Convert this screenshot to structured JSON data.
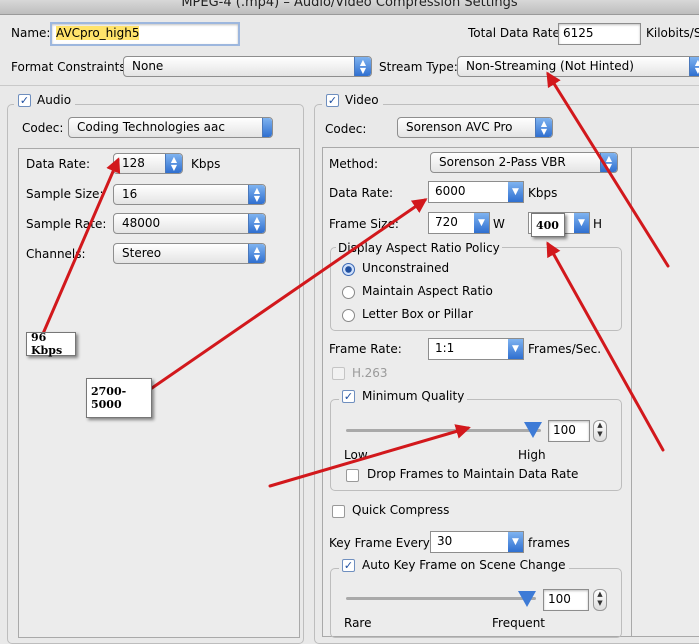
{
  "window": {
    "title": "MPEG-4 (.mp4) – Audio/Video Compression Settings"
  },
  "name": {
    "label": "Name:",
    "value": "AVCpro_high5"
  },
  "total_rate": {
    "label": "Total Data Rate:",
    "value": "6125",
    "unit": "Kilobits/Se"
  },
  "format_constraints": {
    "label": "Format Constraints:",
    "value": "None"
  },
  "stream_type": {
    "label": "Stream Type:",
    "value": "Non-Streaming (Not Hinted)"
  },
  "audio": {
    "checkbox_label": "Audio",
    "codec_label": "Codec:",
    "codec": "Coding Technologies aac",
    "data_rate_label": "Data Rate:",
    "data_rate": "128",
    "data_rate_unit": "Kbps",
    "sample_size_label": "Sample Size:",
    "sample_size": "16",
    "sample_rate_label": "Sample Rate:",
    "sample_rate": "48000",
    "channels_label": "Channels:",
    "channels": "Stereo"
  },
  "video": {
    "checkbox_label": "Video",
    "codec_label": "Codec:",
    "codec": "Sorenson AVC Pro",
    "method_label": "Method:",
    "method": "Sorenson 2-Pass VBR",
    "data_rate_label": "Data Rate:",
    "data_rate": "6000",
    "data_rate_unit": "Kbps",
    "frame_size_label": "Frame Size:",
    "frame_width": "720",
    "w_label": "W",
    "h_label": "H",
    "aspect_title": "Display Aspect Ratio Policy",
    "aspect_options": [
      "Unconstrained",
      "Maintain Aspect Ratio",
      "Letter Box or Pillar"
    ],
    "frame_rate_label": "Frame Rate:",
    "frame_rate": "1:1",
    "frame_rate_unit": "Frames/Sec.",
    "h263_label": "H.263",
    "min_quality_label": "Minimum Quality",
    "quality_low": "Low",
    "quality_high": "High",
    "quality_value": "100",
    "quality_fraction": 1.0,
    "drop_frames_label": "Drop Frames to Maintain Data Rate",
    "quick_compress_label": "Quick Compress",
    "key_frame_label": "Key Frame Every:",
    "key_frame_value": "30",
    "key_frame_unit": "frames",
    "auto_key_label": "Auto Key Frame on Scene Change",
    "auto_key_rare": "Rare",
    "auto_key_frequent": "Frequent",
    "auto_key_value": "100"
  },
  "annotations": {
    "audio_note": "96 Kbps",
    "video_rate_note": "2700-5000",
    "height_note": "400"
  },
  "colors": {
    "arrow": "#d2181c",
    "accent": "#2f6fd0",
    "highlight": "#ffe36b"
  }
}
